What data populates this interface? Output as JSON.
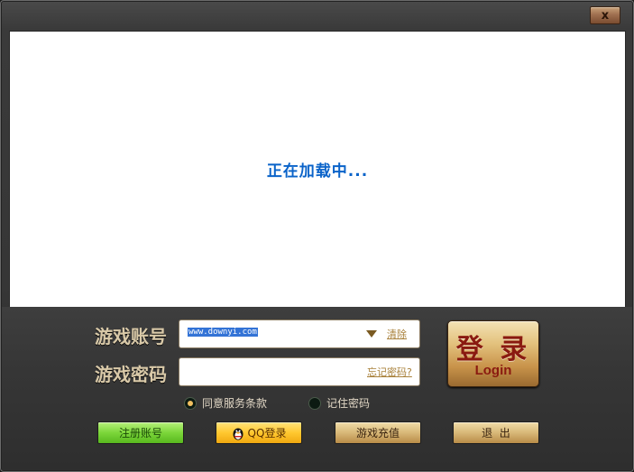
{
  "window": {
    "close_label": "x"
  },
  "web_panel": {
    "loading_text": "正在加载中..."
  },
  "account": {
    "label": "游戏账号",
    "value": "www.downyi.com",
    "clear_link": "清除"
  },
  "password": {
    "label": "游戏密码",
    "value": "",
    "forgot_link": "忘记密码?"
  },
  "login_button": {
    "label_cn": "登 录",
    "label_en": "Login"
  },
  "options": {
    "agree_label": "同意服务条款",
    "agree_checked": true,
    "remember_label": "记住密码",
    "remember_checked": false
  },
  "buttons": {
    "register": "注册账号",
    "qq_login": "QQ登录",
    "recharge": "游戏充值",
    "exit": "退  出"
  },
  "colors": {
    "loading_text": "#0a63c9",
    "label_text": "#d9c9a8",
    "link": "#a8803a",
    "login_text": "#8a1a10"
  }
}
